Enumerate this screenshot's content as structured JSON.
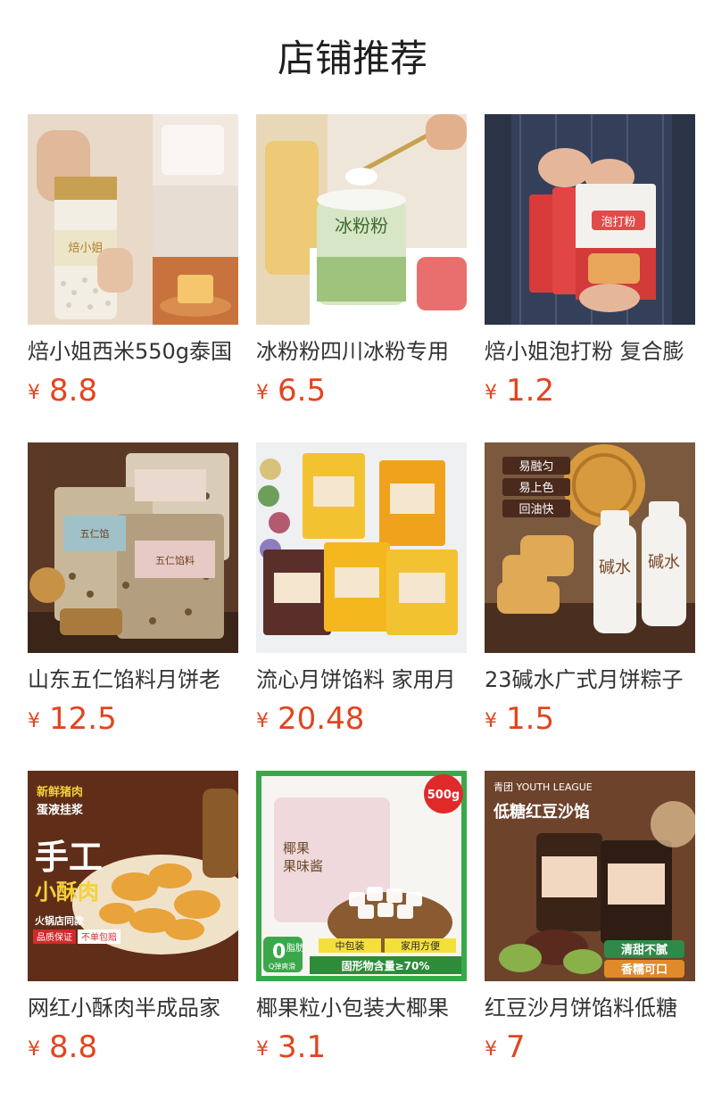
{
  "page": {
    "title": "店铺推荐"
  },
  "currency_symbol": "¥",
  "products": [
    {
      "name": "焙小姐西米550g泰国",
      "price": "8.8",
      "image_text": [
        "焙小姐"
      ],
      "icon": "tapioca-pearl-jar-image"
    },
    {
      "name": "冰粉粉四川冰粉专用",
      "price": "6.5",
      "image_text": [
        "冰粉粉"
      ],
      "icon": "ice-jelly-powder-jar-image"
    },
    {
      "name": "焙小姐泡打粉 复合膨",
      "price": "1.2",
      "image_text": [
        "泡打粉"
      ],
      "icon": "baking-powder-packets-image"
    },
    {
      "name": "山东五仁馅料月饼老",
      "price": "12.5",
      "image_text": [
        "五仁馅",
        "五仁馅料"
      ],
      "icon": "mooncake-filling-bags-image"
    },
    {
      "name": "流心月饼馅料 家用月",
      "price": "20.48",
      "image_text": [],
      "icon": "lava-mooncake-filling-packs-image"
    },
    {
      "name": "23碱水广式月饼粽子",
      "price": "1.5",
      "image_text": [
        "易融匀",
        "易上色",
        "回油快",
        "碱水"
      ],
      "icon": "alkaline-water-bottles-image"
    },
    {
      "name": "网红小酥肉半成品家",
      "price": "8.8",
      "image_text": [
        "新鲜猪肉",
        "蛋液挂浆",
        "手工",
        "小酥肉",
        "火锅店同款",
        "品质保证",
        "不单包赔"
      ],
      "icon": "fried-pork-bites-image"
    },
    {
      "name": "椰果粒小包装大椰果",
      "price": "3.1",
      "image_text": [
        "500g",
        "椰果",
        "果味酱",
        "0",
        "脂肪",
        "Q弹爽滑",
        "中包装",
        "家用方便",
        "固形物含量≥70%"
      ],
      "icon": "coconut-jelly-bag-image"
    },
    {
      "name": "红豆沙月饼馅料低糖",
      "price": "7",
      "image_text": [
        "青团 YOUTH LEAGUE",
        "低糖红豆沙馅",
        "清甜不腻",
        "香糯可口"
      ],
      "icon": "red-bean-paste-bags-image"
    }
  ]
}
